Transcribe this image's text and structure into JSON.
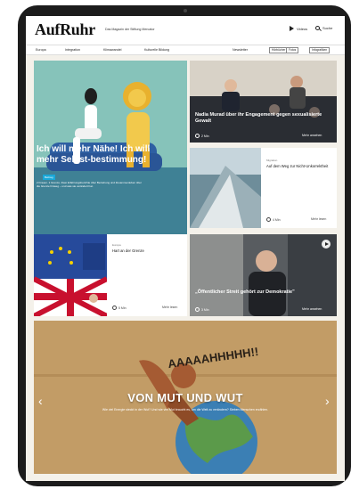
{
  "header": {
    "logo": "AufRuhr",
    "tagline": "Das Magazin der Stiftung Mercator",
    "videos_label": "Videos",
    "search_label": "Suche"
  },
  "nav": {
    "items": [
      "Europa",
      "Integration",
      "Klimawandel",
      "Kulturelle Bildung"
    ],
    "newsletter_label": "Newsletter",
    "buttons": [
      "Hörbücher",
      "Fotos",
      "Infografiken"
    ]
  },
  "hero": {
    "badge": "Beitrag",
    "title": "Ich will mehr Nähe! Ich will mehr Selbst-bestimmung!",
    "teaser": "2 Frauen. 1 Grenze. Zwei Erfahrungsberichte über Beziehung und Zusammenleben über die Grenze hinweg – und was sie verändert hat.",
    "duration": "6 Min",
    "more": "Mehr lesen"
  },
  "card_talk": {
    "title": "Nadia Murad über ihr Engagement gegen sexualisierte Gewalt",
    "duration": "2 Min",
    "more": "Mehr ansehen"
  },
  "card_boat": {
    "label": "Migration",
    "title": "Auf dem Weg zur Nicht-Unkorrektheit",
    "duration": "4 Min",
    "more": "Mehr lesen"
  },
  "card_eu": {
    "label": "Europa",
    "title": "Hart an der Grenze",
    "duration": "5 Min",
    "more": "Mehr lesen"
  },
  "card_speaker": {
    "title": "„Öffentlicher Streit gehört zur Demokratie\"",
    "duration": "3 Min",
    "more": "Mehr ansehen"
  },
  "banner": {
    "shout": "AAAAAHHHHH!!",
    "title": "VON MUT UND WUT",
    "subtitle": "Wie viel Energie steckt in der Wut? Und wie viel Mut braucht es, um die Welt zu verändern? Sieben Menschen erzählen.",
    "prev": "‹",
    "next": "›"
  },
  "colors": {
    "accent": "#1aa8d8",
    "hero_bg": "#86c3ba",
    "cardboard": "#c29c66"
  }
}
